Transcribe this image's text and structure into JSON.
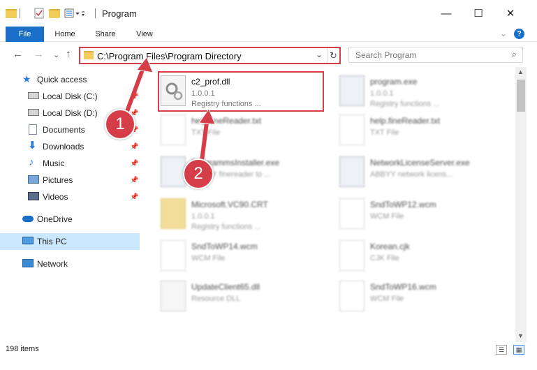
{
  "window": {
    "title": "Program",
    "minimize": "—",
    "maximize": "☐",
    "close": "✕"
  },
  "ribbon": {
    "tabs": [
      "File",
      "Home",
      "Share",
      "View"
    ],
    "collapse": "⌄",
    "help": "?"
  },
  "nav": {
    "back": "←",
    "forward": "→",
    "recent": "⌄",
    "up": "↑"
  },
  "address": {
    "path": "C:\\Program Files\\Program Directory",
    "dropdown": "⌄",
    "refresh": "↻"
  },
  "search": {
    "placeholder": "Search Program",
    "icon": "⌕"
  },
  "sidebar": {
    "items": [
      {
        "label": "Quick access",
        "icon": "star-icon"
      },
      {
        "label": "Local Disk (C:)",
        "icon": "drive-icon",
        "pinned": true
      },
      {
        "label": "Local Disk (D:)",
        "icon": "drive-icon",
        "pinned": true
      },
      {
        "label": "Documents",
        "icon": "documents-icon",
        "pinned": true
      },
      {
        "label": "Downloads",
        "icon": "download-icon",
        "pinned": true
      },
      {
        "label": "Music",
        "icon": "music-icon",
        "pinned": true
      },
      {
        "label": "Pictures",
        "icon": "pictures-icon",
        "pinned": true
      },
      {
        "label": "Videos",
        "icon": "videos-icon",
        "pinned": true
      },
      {
        "label": "OneDrive",
        "icon": "cloud-icon"
      },
      {
        "label": "This PC",
        "icon": "computer-icon",
        "selected": true
      },
      {
        "label": "Network",
        "icon": "network-icon"
      }
    ],
    "pin_glyph": "📌"
  },
  "files": [
    {
      "name": "c2_prof.dll",
      "line1": "1.0.0.1",
      "line2": "Registry functions ...",
      "icon": "gear-file-icon"
    },
    {
      "name": "program.exe",
      "line1": "1.0.0.1",
      "line2": "Registry functions ...",
      "icon": "app-icon"
    },
    {
      "name": "help.fineReader.txt",
      "line1": "TXT File",
      "line2": "",
      "icon": "document-icon"
    },
    {
      "name": "help.fineReader.txt",
      "line1": "TXT File",
      "line2": "",
      "icon": "document-icon"
    },
    {
      "name": "ProgrammsInstaller.exe",
      "line1": "ABBYY finereader to ...",
      "line2": "",
      "icon": "app-icon"
    },
    {
      "name": "NetworkLicenseServer.exe",
      "line1": "ABBYY network licens...",
      "line2": "",
      "icon": "app-icon"
    },
    {
      "name": "Microsoft.VC90.CRT",
      "line1": "1.0.0.1",
      "line2": "Registry functions ...",
      "icon": "folder-file-icon"
    },
    {
      "name": "SndToWP12.wcm",
      "line1": "WCM File",
      "line2": "",
      "icon": "document-icon"
    },
    {
      "name": "SndToWP14.wcm",
      "line1": "WCM File",
      "line2": "",
      "icon": "document-icon"
    },
    {
      "name": "Korean.cjk",
      "line1": "CJK File",
      "line2": "",
      "icon": "document-icon"
    },
    {
      "name": "UpdateClient65.dll",
      "line1": "Resource DLL",
      "line2": "",
      "icon": "gear-file-icon"
    },
    {
      "name": "SndToWP16.wcm",
      "line1": "WCM File",
      "line2": "",
      "icon": "document-icon"
    }
  ],
  "annotations": {
    "step1": "1",
    "step2": "2",
    "color": "#d53e48"
  },
  "status": {
    "item_count": "198 items",
    "view_details": "☰",
    "view_large": "▦"
  },
  "scrollbar": {
    "up": "▲",
    "down": "▼"
  }
}
